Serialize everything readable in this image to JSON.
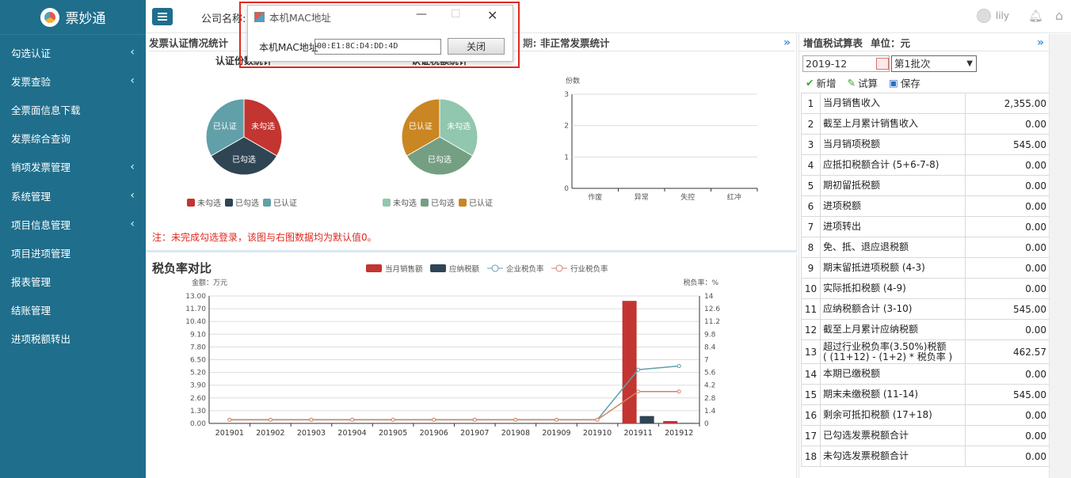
{
  "brand": {
    "name": "票妙通"
  },
  "sidebar": {
    "items": [
      {
        "label": "勾选认证",
        "has_arrow": true
      },
      {
        "label": "发票查验",
        "has_arrow": true
      },
      {
        "label": "全票面信息下载",
        "has_arrow": false
      },
      {
        "label": "发票综合查询",
        "has_arrow": false
      },
      {
        "label": "销项发票管理",
        "has_arrow": true
      },
      {
        "label": "系统管理",
        "has_arrow": true
      },
      {
        "label": "项目信息管理",
        "has_arrow": true
      },
      {
        "label": "项目进项管理",
        "has_arrow": false
      },
      {
        "label": "报表管理",
        "has_arrow": false
      },
      {
        "label": "结账管理",
        "has_arrow": false
      },
      {
        "label": "进项税额转出",
        "has_arrow": false
      }
    ]
  },
  "topbar": {
    "company_label": "公司名称:",
    "user": "lily"
  },
  "dialog": {
    "title": "本机MAC地址",
    "mac_label": "本机MAC地址",
    "mac_value": "00:E1:8C:D4:DD:4D",
    "close_label": "关闭"
  },
  "panel1": {
    "title": "发票认证情况统计",
    "right_title": "非正常发票统计",
    "hidden_suffix": "期:",
    "note": "注：未完成勾选登录，该图与右图数据均为默认值0。"
  },
  "panel2": {
    "title": "税负率对比"
  },
  "right_panel": {
    "title": "增值税试算表",
    "unit": "单位：元",
    "period": "2019-12",
    "batch": "第1批次",
    "actions": [
      "新增",
      "试算",
      "保存"
    ],
    "rows": [
      {
        "no": "1",
        "name": "当月销售收入",
        "value": "2,355.00"
      },
      {
        "no": "2",
        "name": "截至上月累计销售收入",
        "value": "0.00"
      },
      {
        "no": "3",
        "name": "当月销项税额",
        "value": "545.00"
      },
      {
        "no": "4",
        "name": "应抵扣税额合计 (5+6-7-8)",
        "value": "0.00"
      },
      {
        "no": "5",
        "name": "期初留抵税额",
        "value": "0.00"
      },
      {
        "no": "6",
        "name": "进项税额",
        "value": "0.00"
      },
      {
        "no": "7",
        "name": "进项转出",
        "value": "0.00"
      },
      {
        "no": "8",
        "name": "免、抵、退应退税额",
        "value": "0.00"
      },
      {
        "no": "9",
        "name": "期末留抵进项税额 (4-3)",
        "value": "0.00"
      },
      {
        "no": "10",
        "name": "实际抵扣税额 (4-9)",
        "value": "0.00"
      },
      {
        "no": "11",
        "name": "应纳税额合计 (3-10)",
        "value": "545.00"
      },
      {
        "no": "12",
        "name": "截至上月累计应纳税额",
        "value": "0.00"
      },
      {
        "no": "13",
        "name": "超过行业税负率(3.50%)税额\n( (11+12) - (1+2) * 税负率 )",
        "value": "462.57"
      },
      {
        "no": "14",
        "name": "本期已缴税额",
        "value": "0.00"
      },
      {
        "no": "15",
        "name": "期末未缴税额 (11-14)",
        "value": "545.00"
      },
      {
        "no": "16",
        "name": "剩余可抵扣税额 (17+18)",
        "value": "0.00"
      },
      {
        "no": "17",
        "name": "已勾选发票税额合计",
        "value": "0.00"
      },
      {
        "no": "18",
        "name": "未勾选发票税额合计",
        "value": "0.00"
      }
    ]
  },
  "colors": {
    "red": "#c23531",
    "dark": "#2f4554",
    "teal": "#61a0a8",
    "orange": "#d48265",
    "mint": "#91c7ae",
    "green": "#749f83",
    "gold": "#ca8622",
    "line_enterprise": "#61a0a8",
    "line_industry": "#d48265"
  },
  "chart_data": [
    {
      "type": "pie",
      "title": "认证份数统计",
      "slices": [
        {
          "label": "未勾选",
          "value": 1
        },
        {
          "label": "已勾选",
          "value": 1
        },
        {
          "label": "已认证",
          "value": 1
        }
      ],
      "legend": [
        "未勾选",
        "已勾选",
        "已认证"
      ],
      "legend_placement": "bottom"
    },
    {
      "type": "pie",
      "title": "认证税额统计",
      "slices": [
        {
          "label": "未勾选",
          "value": 1
        },
        {
          "label": "已勾选",
          "value": 1
        },
        {
          "label": "已认证",
          "value": 1
        }
      ],
      "legend": [
        "未勾选",
        "已勾选",
        "已认证"
      ],
      "legend_placement": "bottom"
    },
    {
      "type": "bar",
      "ylabel": "份数",
      "categories": [
        "作废",
        "异常",
        "失控",
        "红冲"
      ],
      "values": [
        0,
        0,
        0,
        0
      ],
      "ylim": [
        0,
        3
      ],
      "yticks": [
        0,
        1,
        2,
        3
      ]
    },
    {
      "type": "bar",
      "ylabel": "金额：万元",
      "y2label": "税负率：%",
      "categories": [
        "201901",
        "201902",
        "201903",
        "201904",
        "201905",
        "201906",
        "201907",
        "201908",
        "201909",
        "201910",
        "201911",
        "201912"
      ],
      "series": [
        {
          "name": "当月销售额",
          "kind": "bar",
          "values": [
            0,
            0,
            0,
            0,
            0,
            0,
            0,
            0,
            0,
            0,
            12.5,
            0.24
          ]
        },
        {
          "name": "应纳税额",
          "kind": "bar",
          "values": [
            0,
            0,
            0,
            0,
            0,
            0,
            0,
            0,
            0,
            0,
            0.75,
            0.05
          ]
        },
        {
          "name": "企业税负率",
          "kind": "line",
          "axis": "right",
          "values": [
            0.4,
            0.4,
            0.4,
            0.4,
            0.4,
            0.4,
            0.4,
            0.4,
            0.4,
            0.4,
            5.9,
            6.3
          ]
        },
        {
          "name": "行业税负率",
          "kind": "line",
          "axis": "right",
          "values": [
            0.4,
            0.4,
            0.4,
            0.4,
            0.4,
            0.4,
            0.4,
            0.4,
            0.4,
            0.4,
            3.5,
            3.5
          ]
        }
      ],
      "ylim": [
        0,
        13
      ],
      "yticks": [
        "0.00",
        "1.30",
        "2.60",
        "3.90",
        "5.20",
        "6.50",
        "7.80",
        "9.10",
        "10.40",
        "11.70",
        "13.00"
      ],
      "y2lim": [
        0,
        14
      ],
      "y2ticks": [
        "0",
        "1.4",
        "2.8",
        "4.2",
        "5.6",
        "7",
        "8.4",
        "9.8",
        "11.2",
        "12.6",
        "14"
      ],
      "legend_placement": "top"
    }
  ]
}
